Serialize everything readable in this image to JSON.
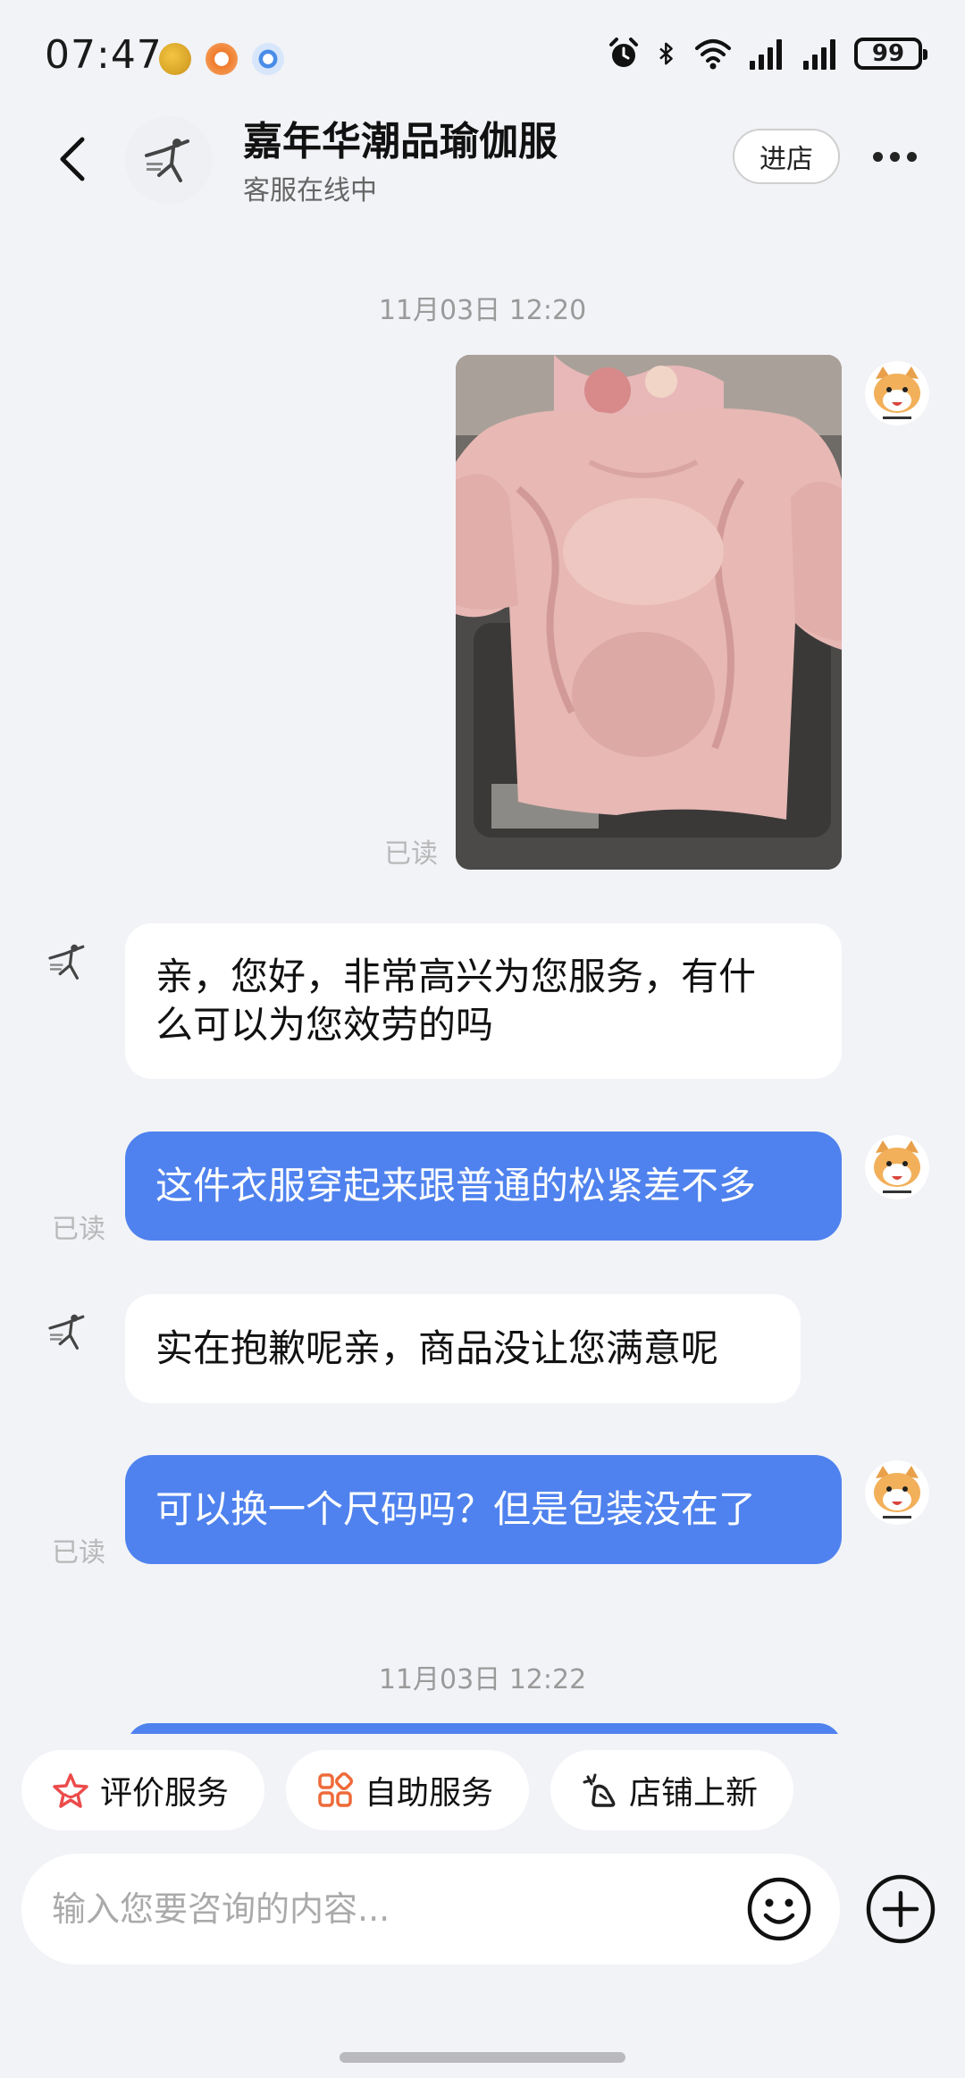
{
  "status_bar": {
    "time": "07:47",
    "battery": "99"
  },
  "header": {
    "shop_name": "嘉年华潮品瑜伽服",
    "status": "客服在线中",
    "enter_shop_label": "进店"
  },
  "chat": {
    "timestamp_1": "11月03日 12:20",
    "read_label": "已读",
    "messages": [
      {
        "from": "user",
        "type": "image",
        "read": "已读"
      },
      {
        "from": "shop",
        "text_line1": "亲，您好，非常高兴为您服务，有什",
        "text_line2": "么可以为您效劳的吗"
      },
      {
        "from": "user",
        "text": "这件衣服穿起来跟普通的松紧差不多",
        "read": "已读"
      },
      {
        "from": "shop",
        "text": "实在抱歉呢亲，商品没让您满意呢"
      },
      {
        "from": "user",
        "text": "可以换一个尺码吗？但是包装没在了",
        "read": "已读"
      }
    ],
    "timestamp_2": "11月03日 12:22"
  },
  "quick_actions": [
    {
      "label": "评价服务",
      "icon": "star-icon"
    },
    {
      "label": "自助服务",
      "icon": "grid-icon"
    },
    {
      "label": "店铺上新",
      "icon": "sparkle-icon"
    }
  ],
  "input": {
    "placeholder": "输入您要咨询的内容..."
  },
  "colors": {
    "accent": "#4f82ee",
    "background": "#f2f3f7",
    "bubble_in": "#ffffff"
  }
}
